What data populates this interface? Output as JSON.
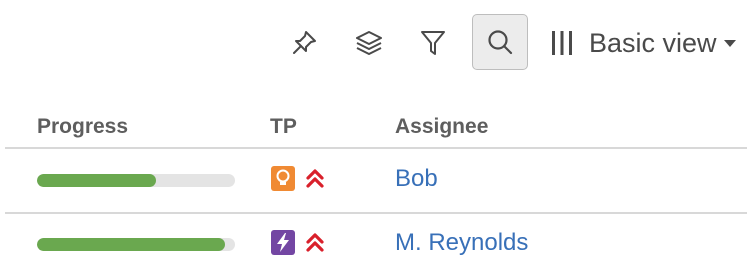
{
  "toolbar": {
    "icons": {
      "pin": "pin-icon",
      "layers": "layers-icon",
      "filter": "filter-icon",
      "search": "search-icon",
      "view": "columns-icon",
      "caret": "caret-down-icon"
    },
    "view_label": "Basic view"
  },
  "table": {
    "headers": {
      "progress": "Progress",
      "tp": "TP",
      "assignee": "Assignee"
    },
    "rows": [
      {
        "progress": 0.6,
        "type_icon": "idea-icon",
        "type_color": "#f08a33",
        "priority_icon": "priority-highest-icon",
        "assignee": "Bob"
      },
      {
        "progress": 0.95,
        "type_icon": "epic-icon",
        "type_color": "#7346a3",
        "priority_icon": "priority-highest-icon",
        "assignee": "M. Reynolds"
      }
    ]
  },
  "colors": {
    "progress_fill": "#6aa84f",
    "progress_track": "#e4e4e4",
    "link": "#3870b8",
    "priority": "#d9202b"
  }
}
